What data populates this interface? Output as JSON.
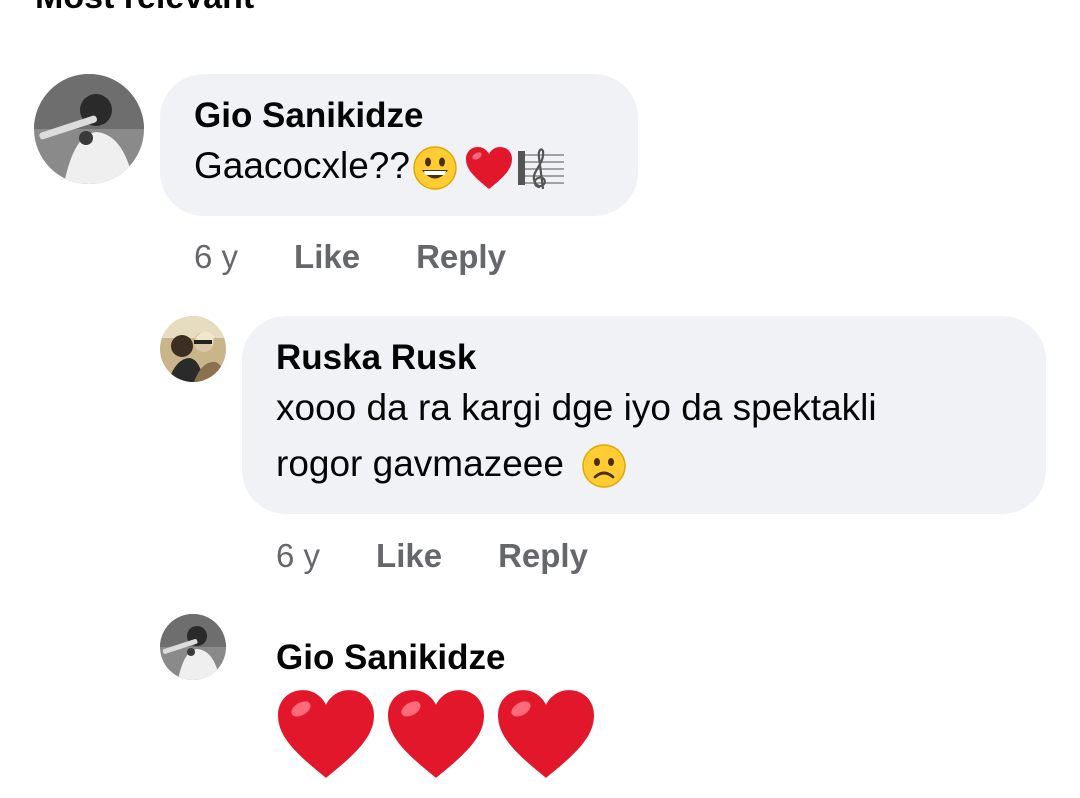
{
  "header": {
    "sort_label": "Most relevant"
  },
  "comments": [
    {
      "author": "Gio Sanikidze",
      "text": "Gaacocxle??",
      "emojis": [
        "grinning-face-emoji",
        "red-heart-emoji",
        "musical-score-emoji"
      ],
      "time": "6 y",
      "like_label": "Like",
      "reply_label": "Reply"
    },
    {
      "author": "Ruska Rusk",
      "text_line1": "xooo da ra kargi dge iyo da spektakli",
      "text_line2": "rogor gavmazeee",
      "emojis": [
        "frowning-face-emoji"
      ],
      "time": "6 y",
      "like_label": "Like",
      "reply_label": "Reply"
    },
    {
      "author": "Gio Sanikidze",
      "emojis": [
        "red-heart-emoji",
        "red-heart-emoji",
        "red-heart-emoji"
      ]
    }
  ],
  "colors": {
    "bubble": "#f0f2f5",
    "meta_text": "#65676b",
    "primary_text": "#050505",
    "heart": "#e3172b",
    "emoji_yellow": "#ffcc33"
  }
}
